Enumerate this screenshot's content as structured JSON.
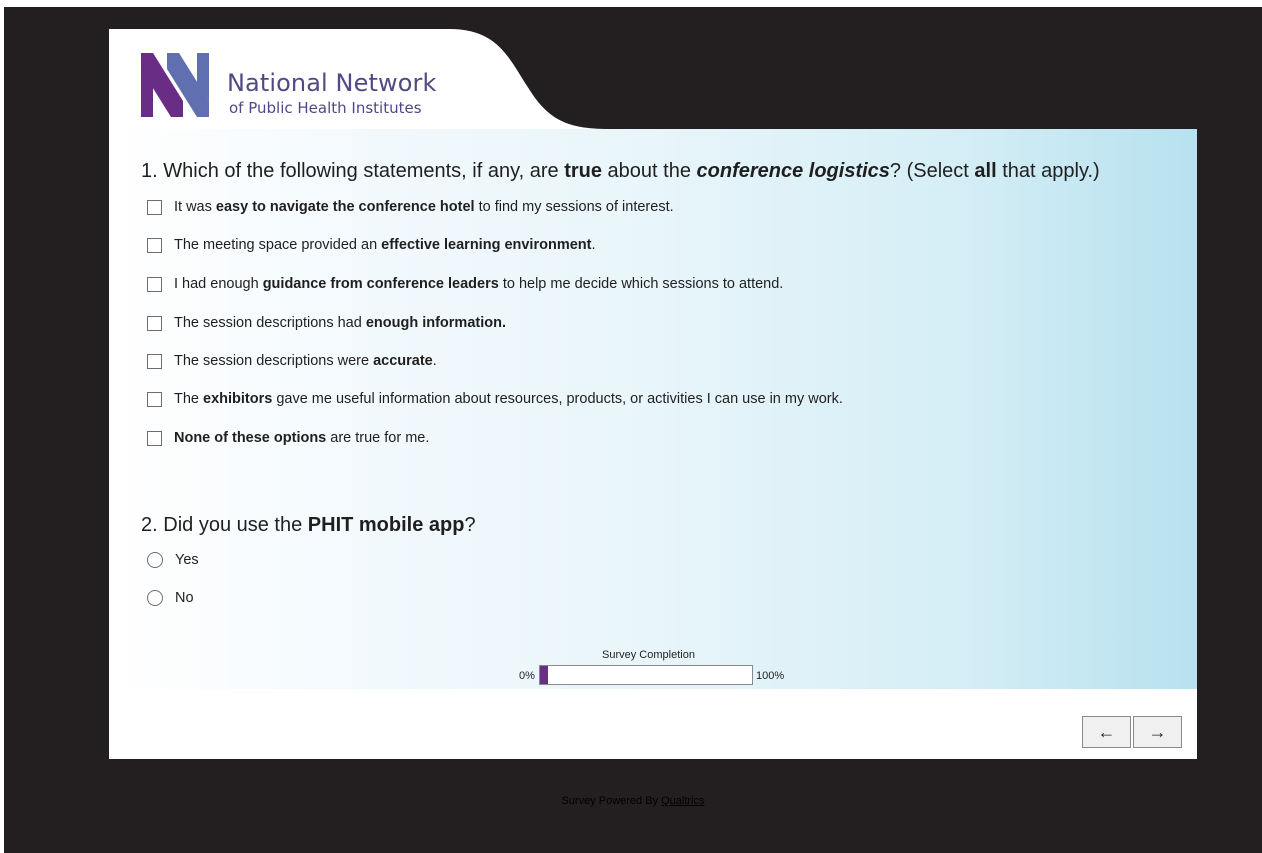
{
  "header": {
    "org_name": "National Network",
    "org_sub": "of Public Health Institutes"
  },
  "question1": {
    "number": "1.",
    "parts": [
      "Which of the following statements, if any, are ",
      "true",
      " about the ",
      "conference logistics",
      "? (Select ",
      "all",
      " that apply.)"
    ],
    "options": [
      [
        "It was ",
        "easy to navigate the conference hotel",
        " to find my sessions of interest."
      ],
      [
        "The meeting space provided an ",
        "effective learning environment",
        "."
      ],
      [
        "I had enough ",
        "guidance from conference leaders",
        " to help me decide which sessions to attend."
      ],
      [
        "The session descriptions had ",
        "enough information.",
        ""
      ],
      [
        "The session descriptions were ",
        "accurate",
        "."
      ],
      [
        "The ",
        "exhibitors",
        " gave me useful information about resources, products, or activities I can use in my work."
      ],
      [
        "",
        "None of these options",
        " are true for me."
      ]
    ]
  },
  "question2": {
    "number": "2.",
    "parts": [
      "Did you use the ",
      "PHIT mobile app",
      "?"
    ],
    "options": [
      "Yes",
      "No"
    ]
  },
  "progress": {
    "label": "Survey Completion",
    "min_label": "0%",
    "max_label": "100%",
    "fraction": 0.04,
    "fill_color": "#6a2d86"
  },
  "nav": {
    "back_label": "←",
    "next_label": "→"
  },
  "footer": {
    "prefix": "Survey Powered By ",
    "link": "Qualtrics"
  }
}
